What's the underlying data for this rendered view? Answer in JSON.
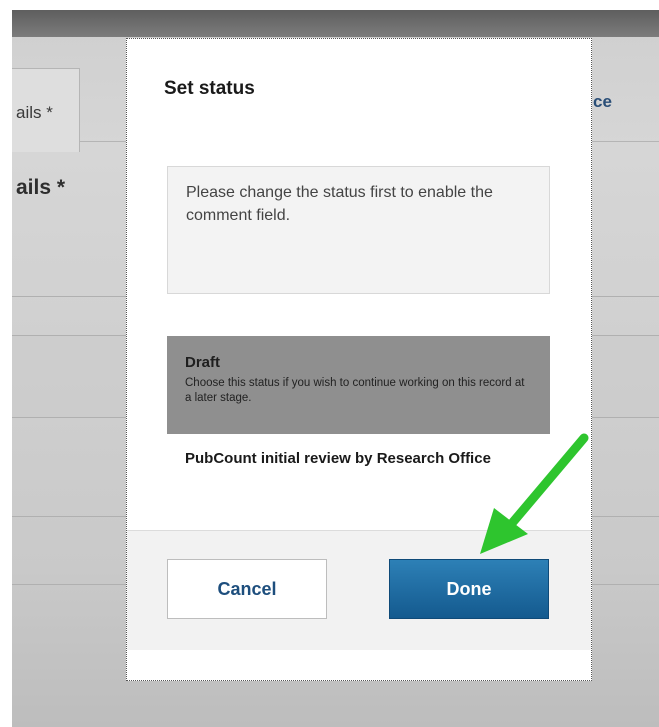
{
  "background": {
    "left_tab_label": "ails *",
    "right_tab_label": "ffice",
    "section_heading": "ails *"
  },
  "dialog": {
    "title": "Set status",
    "comment_hint": "Please change the status first to enable the comment field.",
    "statuses": [
      {
        "name": "Draft",
        "description": "Choose this status if you wish to continue working on this record at a later stage.",
        "selected": true
      },
      {
        "name": "PubCount initial review by Research Office",
        "description": "",
        "selected": false
      }
    ],
    "buttons": {
      "cancel_label": "Cancel",
      "done_label": "Done"
    }
  },
  "annotation": {
    "arrow_color": "#2ec52e",
    "arrow_icon": "green-arrow-pointing-to-done"
  },
  "colors": {
    "done_button": "#1a6aa3",
    "selected_status": "#8f8f8f",
    "link_blue": "#1d4e7d"
  }
}
